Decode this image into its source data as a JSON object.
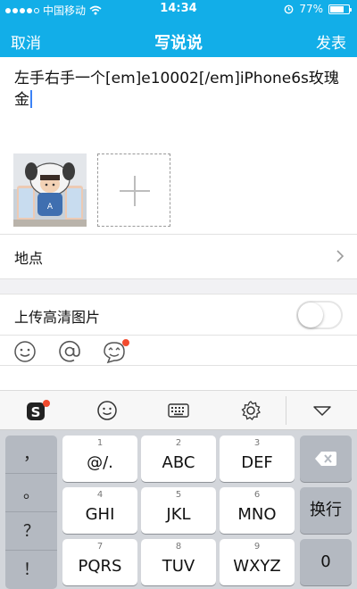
{
  "status_bar": {
    "carrier": "中国移动",
    "time": "14:34",
    "battery_percent_text": "77%",
    "battery_level": 0.77
  },
  "nav": {
    "cancel_label": "取消",
    "title": "写说说",
    "publish_label": "发表"
  },
  "compose": {
    "text": "左手右手一个[em]e10002[/em]iPhone6s玫瑰金"
  },
  "photos": {
    "add_photo_icon": "plus-icon"
  },
  "location": {
    "label": "地点"
  },
  "upload_hd": {
    "label": "上传高清图片",
    "enabled": false
  },
  "tools": [
    "emoji-icon",
    "at-icon",
    "doodle-icon"
  ],
  "keyboard_toolbar": [
    "sogou-logo-icon",
    "emoji-icon",
    "keyboard-icon",
    "settings-icon",
    "hide-keyboard-icon"
  ],
  "keyboard": {
    "punctuation": [
      "，",
      "。",
      "？",
      "！"
    ],
    "keys": [
      {
        "num": "1",
        "letters": "@/."
      },
      {
        "num": "2",
        "letters": "ABC"
      },
      {
        "num": "3",
        "letters": "DEF"
      },
      {
        "num": "4",
        "letters": "GHI"
      },
      {
        "num": "5",
        "letters": "JKL"
      },
      {
        "num": "6",
        "letters": "MNO"
      },
      {
        "num": "7",
        "letters": "PQRS"
      },
      {
        "num": "8",
        "letters": "TUV"
      },
      {
        "num": "9",
        "letters": "WXYZ"
      }
    ],
    "newline_label": "换行",
    "zero_label": "0"
  },
  "colors": {
    "header_blue": "#12aee8",
    "badge_red": "#f24b2e",
    "caret_blue": "#3c82f6"
  }
}
